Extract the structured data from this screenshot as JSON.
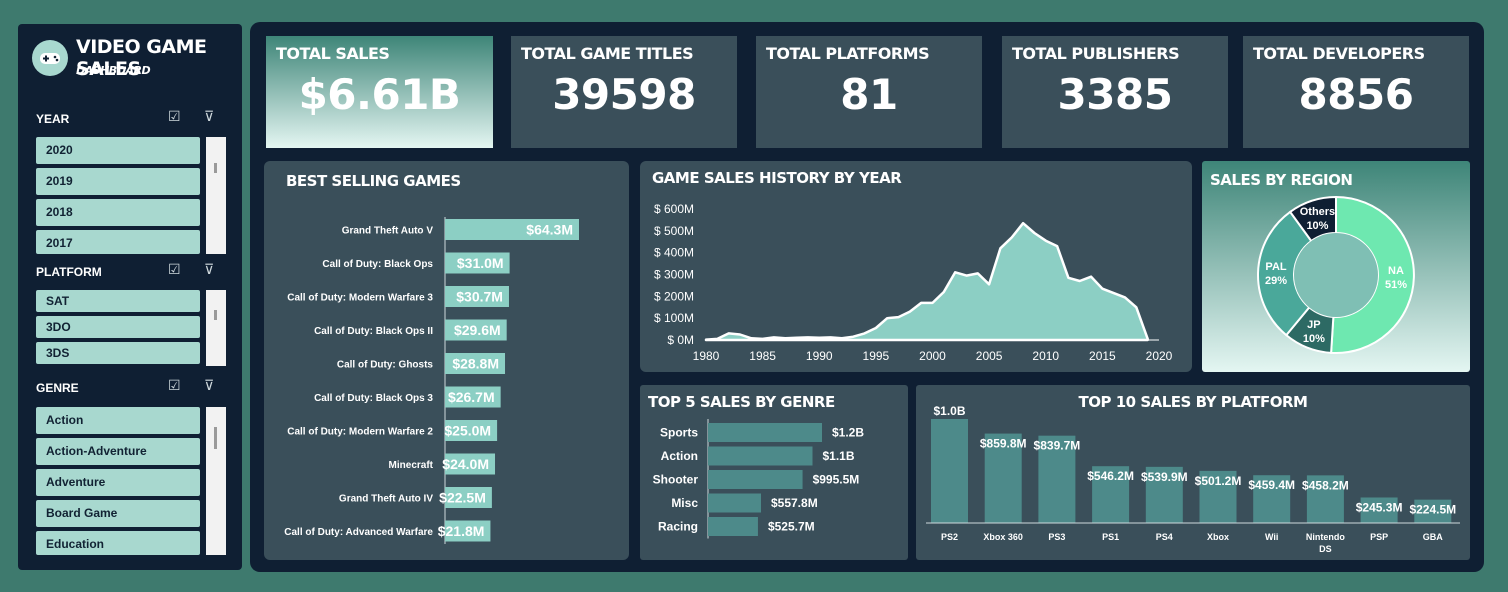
{
  "header": {
    "title": "VIDEO GAME SALES",
    "subtitle": "DASHBOARD"
  },
  "slicers": {
    "year": {
      "label": "YEAR",
      "items": [
        "2020",
        "2019",
        "2018",
        "2017"
      ]
    },
    "platform": {
      "label": "PLATFORM",
      "items": [
        "SAT",
        "3DO",
        "3DS"
      ]
    },
    "genre": {
      "label": "GENRE",
      "items": [
        "Action",
        "Action-Adventure",
        "Adventure",
        "Board Game",
        "Education"
      ]
    }
  },
  "kpis": [
    {
      "label": "TOTAL SALES",
      "value": "$6.61B"
    },
    {
      "label": "TOTAL GAME TITLES",
      "value": "39598"
    },
    {
      "label": "TOTAL PLATFORMS",
      "value": "81"
    },
    {
      "label": "TOTAL PUBLISHERS",
      "value": "3385"
    },
    {
      "label": "TOTAL DEVELOPERS",
      "value": "8856"
    }
  ],
  "colors": {
    "accent": "#8ccfc4",
    "panel": "#3a4f5a",
    "bg": "#0f1f33",
    "na": "#6ee8b0",
    "pal": "#4aa89a",
    "jp": "#2d6a64",
    "others": "#0f1f33"
  },
  "chart_data": [
    {
      "id": "best_selling",
      "type": "bar",
      "orientation": "horizontal",
      "title": "BEST SELLING GAMES",
      "categories": [
        "Grand Theft Auto V",
        "Call of Duty: Black Ops",
        "Call of Duty: Modern Warfare 3",
        "Call of Duty: Black Ops II",
        "Call of Duty: Ghosts",
        "Call of Duty: Black Ops 3",
        "Call of Duty: Modern Warfare 2",
        "Minecraft",
        "Grand Theft Auto IV",
        "Call of Duty: Advanced Warfare"
      ],
      "values": [
        64.3,
        31.0,
        30.7,
        29.6,
        28.8,
        26.7,
        25.0,
        24.0,
        22.5,
        21.8
      ],
      "labels": [
        "$64.3M",
        "$31.0M",
        "$30.7M",
        "$29.6M",
        "$28.8M",
        "$26.7M",
        "$25.0M",
        "$24.0M",
        "$22.5M",
        "$21.8M"
      ]
    },
    {
      "id": "history",
      "type": "area",
      "title": "GAME SALES HISTORY BY YEAR",
      "x": [
        1980,
        1981,
        1982,
        1983,
        1984,
        1985,
        1986,
        1987,
        1988,
        1989,
        1990,
        1991,
        1992,
        1993,
        1994,
        1995,
        1996,
        1997,
        1998,
        1999,
        2000,
        2001,
        2002,
        2003,
        2004,
        2005,
        2006,
        2007,
        2008,
        2009,
        2010,
        2011,
        2012,
        2013,
        2014,
        2015,
        2016,
        2017,
        2018,
        2019
      ],
      "values": [
        2,
        5,
        30,
        25,
        8,
        5,
        12,
        8,
        10,
        12,
        10,
        12,
        8,
        15,
        30,
        55,
        100,
        105,
        130,
        170,
        170,
        220,
        310,
        295,
        305,
        255,
        420,
        470,
        535,
        490,
        455,
        430,
        285,
        270,
        290,
        235,
        215,
        195,
        150,
        5
      ],
      "xticks": [
        1980,
        1985,
        1990,
        1995,
        2000,
        2005,
        2010,
        2015,
        2020
      ],
      "ytick_labels": [
        "$ 0M",
        "$ 100M",
        "$ 200M",
        "$ 300M",
        "$ 400M",
        "$ 500M",
        "$ 600M"
      ],
      "ylim": [
        0,
        600
      ]
    },
    {
      "id": "region",
      "type": "pie",
      "donut": true,
      "title": "SALES BY REGION",
      "categories": [
        "NA",
        "JP",
        "PAL",
        "Others"
      ],
      "values": [
        51,
        10,
        29,
        10
      ],
      "labels": [
        "51%",
        "10%",
        "29%",
        "10%"
      ]
    },
    {
      "id": "genre",
      "type": "bar",
      "orientation": "horizontal",
      "title": "TOP 5 SALES BY GENRE",
      "categories": [
        "Sports",
        "Action",
        "Shooter",
        "Misc",
        "Racing"
      ],
      "values": [
        1.2,
        1.1,
        0.9955,
        0.5578,
        0.5257
      ],
      "labels": [
        "$1.2B",
        "$1.1B",
        "$995.5M",
        "$557.8M",
        "$525.7M"
      ]
    },
    {
      "id": "platform",
      "type": "bar",
      "title": "TOP 10 SALES BY PLATFORM",
      "categories": [
        "PS2",
        "Xbox 360",
        "PS3",
        "PS1",
        "PS4",
        "Xbox",
        "Wii",
        "Nintendo DS",
        "PSP",
        "GBA"
      ],
      "values": [
        1.0,
        0.8598,
        0.8397,
        0.5462,
        0.5399,
        0.5012,
        0.4594,
        0.4582,
        0.2453,
        0.2245
      ],
      "labels": [
        "$1.0B",
        "$859.8M",
        "$839.7M",
        "$546.2M",
        "$539.9M",
        "$501.2M",
        "$459.4M",
        "$458.2M",
        "$245.3M",
        "$224.5M"
      ]
    }
  ]
}
